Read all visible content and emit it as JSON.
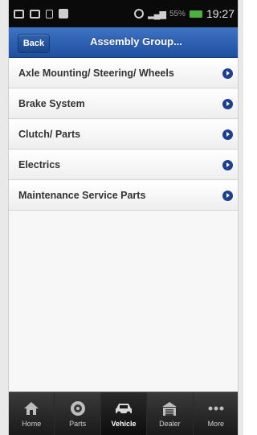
{
  "status_bar": {
    "battery_percent": "55%",
    "time": "19:27"
  },
  "header": {
    "back_label": "Back",
    "title": "Assembly Group..."
  },
  "list": {
    "items": [
      {
        "label": "Axle Mounting/ Steering/ Wheels"
      },
      {
        "label": "Brake System"
      },
      {
        "label": "Clutch/ Parts"
      },
      {
        "label": "Electrics"
      },
      {
        "label": "Maintenance Service Parts"
      }
    ]
  },
  "tabbar": {
    "tabs": [
      {
        "label": "Home",
        "icon": "home-icon"
      },
      {
        "label": "Parts",
        "icon": "parts-icon"
      },
      {
        "label": "Vehicle",
        "icon": "car-icon",
        "active": true
      },
      {
        "label": "Dealer",
        "icon": "dealer-icon"
      },
      {
        "label": "More",
        "icon": "more-icon"
      }
    ]
  },
  "colors": {
    "header_blue": "#2a5db0",
    "arrow_blue": "#1e3f8f",
    "tabbar": "#2a2a2a"
  }
}
